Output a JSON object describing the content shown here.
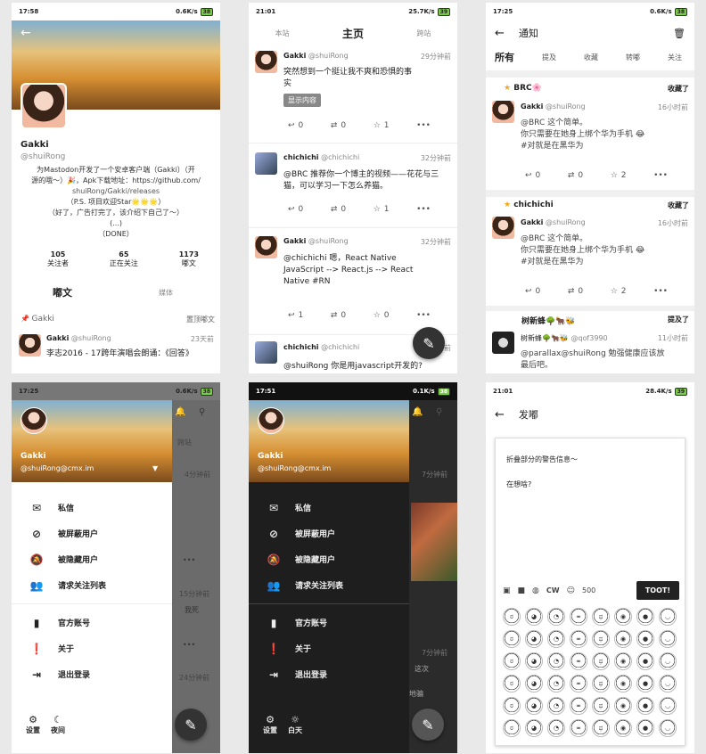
{
  "p1": {
    "status": {
      "time": "17:58",
      "net": "0.6K/s",
      "bat": "38"
    },
    "name": "Gakki",
    "handle": "@shuiRong",
    "bio": [
      "为Mastodon开发了一个安卓客户端（Gakki）（开",
      "源的哦～）🎉，Apk下载地址：https://github.com/",
      "shuiRong/Gakki/releases",
      "（P.S. 项目欢迎Star🌟🌟🌟）",
      "（好了，广告打完了，该介绍下自己了～）",
      "(...)",
      "（DONE）"
    ],
    "stats": [
      {
        "n": "105",
        "l": "关注者"
      },
      {
        "n": "65",
        "l": "正在关注"
      },
      {
        "n": "1173",
        "l": "嘟文"
      }
    ],
    "tabs": [
      "嘟文",
      "媒体"
    ],
    "pinned": "Gakki",
    "pinned_label": "置顶嘟文",
    "post": {
      "author": "Gakki",
      "handle": "@shuiRong",
      "time": "23天前",
      "text": "李志2016 - 17跨年演唱会朗诵：《回答》"
    }
  },
  "p2": {
    "status": {
      "time": "21:01",
      "net": "25.7K/s",
      "bat": "39"
    },
    "tabs": [
      "本站",
      "主页",
      "跨站"
    ],
    "posts": [
      {
        "author": "Gakki",
        "handle": "@shuiRong",
        "time": "29分钟前",
        "text": "突然想到一个挺让我不爽和恐惧的事实",
        "button": "显示内容",
        "counts": [
          "0",
          "0",
          "1"
        ]
      },
      {
        "author": "chichichi",
        "handle": "@chichichi",
        "time": "32分钟前",
        "text": "@BRC 推荐你一个博主的视频——花花与三猫，可以学习一下怎么养猫。",
        "counts": [
          "0",
          "0",
          "1"
        ]
      },
      {
        "author": "Gakki",
        "handle": "@shuiRong",
        "time": "32分钟前",
        "text": "@chichichi 嗯，React Native JavaScript --> React.js --> React Native #RN",
        "counts": [
          "1",
          "0",
          "0"
        ]
      },
      {
        "author": "chichichi",
        "handle": "@chichichi",
        "time": "32分钟前",
        "text": "@shuiRong 你是用javascript开发的?"
      }
    ]
  },
  "p3": {
    "status": {
      "time": "17:25",
      "net": "0.6K/s",
      "bat": "38"
    },
    "title": "通知",
    "tabs": [
      "所有",
      "提及",
      "收藏",
      "转嘟",
      "关注"
    ],
    "notes": [
      {
        "who": "BRC🌸",
        "action": "收藏了",
        "author": "Gakki",
        "handle": "@shuiRong",
        "time": "16小时前",
        "lines": [
          "@BRC 这个简单。",
          "你只需要在她身上绑个华为手机 😂",
          "#对就是在黑华为"
        ],
        "counts": [
          "0",
          "0",
          "2"
        ]
      },
      {
        "who": "chichichi",
        "action": "收藏了",
        "author": "Gakki",
        "handle": "@shuiRong",
        "time": "16小时前",
        "lines": [
          "@BRC 这个简单。",
          "你只需要在她身上绑个华为手机 😂",
          "#对就是在黑华为"
        ],
        "counts": [
          "0",
          "0",
          "2"
        ]
      },
      {
        "who": "树新蜂🌳🐂🐝",
        "action": "提及了",
        "author": "树新蜂🌳🐂🐝",
        "handle": "@qof3990",
        "time": "11小时前",
        "lines": [
          "@parallax@shuiRong 勉强健康应该放",
          "最后吧。"
        ]
      }
    ]
  },
  "p4": {
    "status": {
      "time": "17:25",
      "net": "0.6K/s",
      "bat": "38"
    },
    "name": "Gakki",
    "handle": "@shuiRong@cmx.im",
    "items": [
      "私信",
      "被屏蔽用户",
      "被隐藏用户",
      "请求关注列表",
      "官方账号",
      "关于",
      "退出登录"
    ],
    "footer": [
      "设置",
      "夜间"
    ],
    "bg": {
      "tab": "跨站",
      "t1": "4分钟前",
      "t2": "15分钟前",
      "txt": "我死",
      "t3": "24分钟前"
    }
  },
  "p5": {
    "status": {
      "time": "17:51",
      "net": "0.1K/s",
      "bat": "38"
    },
    "name": "Gakki",
    "handle": "@shuiRong@cmx.im",
    "items": [
      "私信",
      "被屏蔽用户",
      "被隐藏用户",
      "请求关注列表",
      "官方账号",
      "关于",
      "退出登录"
    ],
    "footer": [
      "设置",
      "白天"
    ],
    "bg": {
      "t1": "7分钟前",
      "t2": "7分钟前",
      "txt1": "这次",
      "txt2": "地骗"
    }
  },
  "p6": {
    "status": {
      "time": "21:01",
      "net": "28.4K/s",
      "bat": "39"
    },
    "title": "发嘟",
    "cw_text": "折叠部分的警告信息～",
    "placeholder": "在想啥?",
    "cw": "CW",
    "limit": "500",
    "toot": "TOOT!"
  },
  "colors": {
    "accent": "#222222",
    "star": "#f5a623"
  }
}
